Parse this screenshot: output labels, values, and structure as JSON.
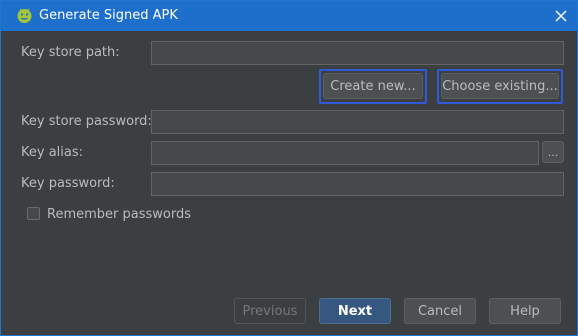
{
  "window": {
    "title": "Generate Signed APK",
    "app_icon": "android-icon",
    "close_icon": "close-icon"
  },
  "form": {
    "key_store_path_label": "Key store path:",
    "key_store_path_value": "",
    "create_new_label": "Create new...",
    "choose_existing_label": "Choose existing...",
    "key_store_password_label": "Key store password:",
    "key_store_password_value": "",
    "key_alias_label": "Key alias:",
    "key_alias_value": "",
    "key_alias_browse_label": "...",
    "key_password_label": "Key password:",
    "key_password_value": "",
    "remember_passwords_label": "Remember passwords",
    "remember_passwords_checked": false
  },
  "footer": {
    "previous_label": "Previous",
    "next_label": "Next",
    "cancel_label": "Cancel",
    "help_label": "Help"
  },
  "colors": {
    "titlebar": "#1e6fcb",
    "background": "#3c3f41",
    "focus_ring": "#2f5bd9",
    "default_button": "#365880"
  }
}
